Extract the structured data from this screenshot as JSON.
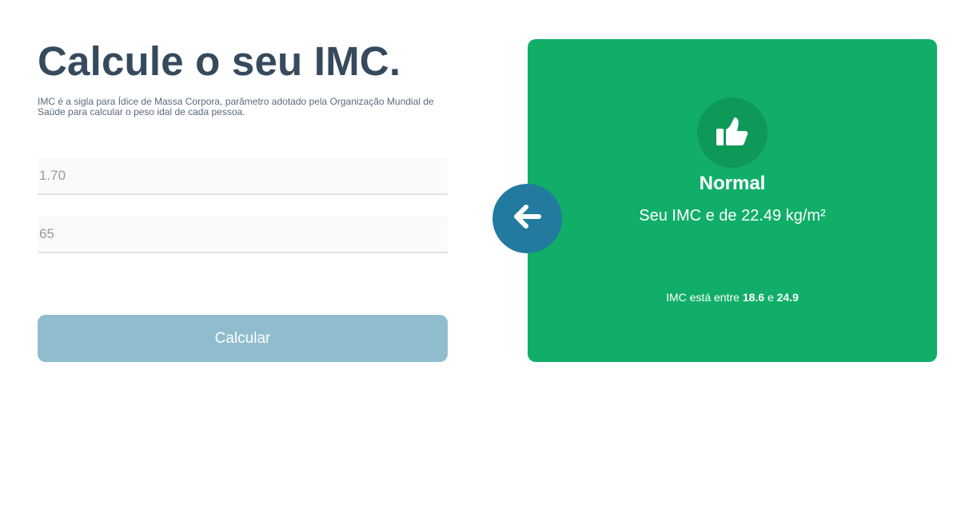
{
  "form": {
    "title": "Calcule o seu IMC.",
    "description": "IMC é a sigla para Ídice de Massa Corpora, parâmetro adotado pela Organização Mundial de Saúde para calcular o peso idal de cada pessoa.",
    "height_value": "1.70",
    "weight_value": "65",
    "calculate_label": "Calcular",
    "button_color": "#90bdcd"
  },
  "result": {
    "icon": "thumbs-up-icon",
    "level": "Normal",
    "imc_text": "Seu IMC e de 22.49 kg/m²",
    "range_prefix": "IMC está entre",
    "range_min": "18.6",
    "range_joiner": "e",
    "range_max": "24.9",
    "card_color": "#10ae69",
    "icon_bg_color": "#0f9958"
  },
  "back_button": {
    "icon": "arrow-left-icon",
    "color": "#227b9f"
  },
  "colors": {
    "title": "#364a5d",
    "input_bg": "#fafafa",
    "input_border": "#e2e2e2"
  }
}
